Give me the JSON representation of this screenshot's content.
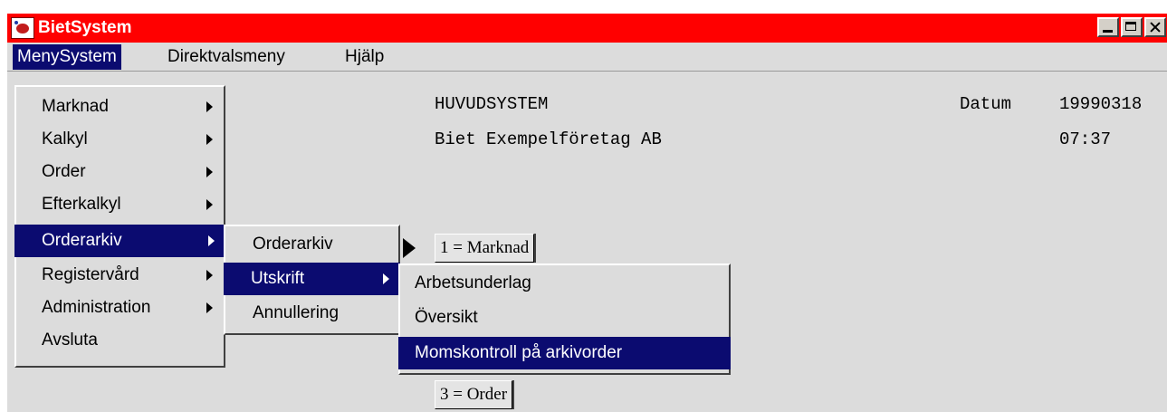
{
  "window": {
    "title": "BietSystem"
  },
  "menubar": {
    "items": [
      "MenySystem",
      "Direktvalsmeny",
      "Hjälp"
    ]
  },
  "header": {
    "title": "HUVUDSYSTEM",
    "company": "Biet Exempelföretag AB",
    "date_label": "Datum",
    "date_value": "19990318",
    "time_value": "07:37"
  },
  "fields": {
    "btn1": "1 = Marknad",
    "btn3": "3 = Order"
  },
  "menu_main": {
    "items": [
      "Marknad",
      "Kalkyl",
      "Order",
      "Efterkalkyl",
      "Orderarkiv",
      "Registervård",
      "Administration",
      "Avsluta"
    ],
    "selected": "Orderarkiv"
  },
  "menu_orderarkiv": {
    "items": [
      "Orderarkiv",
      "Utskrift",
      "Annullering"
    ],
    "selected": "Utskrift"
  },
  "menu_utskrift": {
    "items": [
      "Arbetsunderlag",
      "Översikt",
      "Momskontroll på arkivorder"
    ],
    "selected": "Momskontroll på arkivorder"
  },
  "colors": {
    "titlebar": "#ff0000",
    "selection": "#0b0b70",
    "background": "#dcdcdc"
  }
}
